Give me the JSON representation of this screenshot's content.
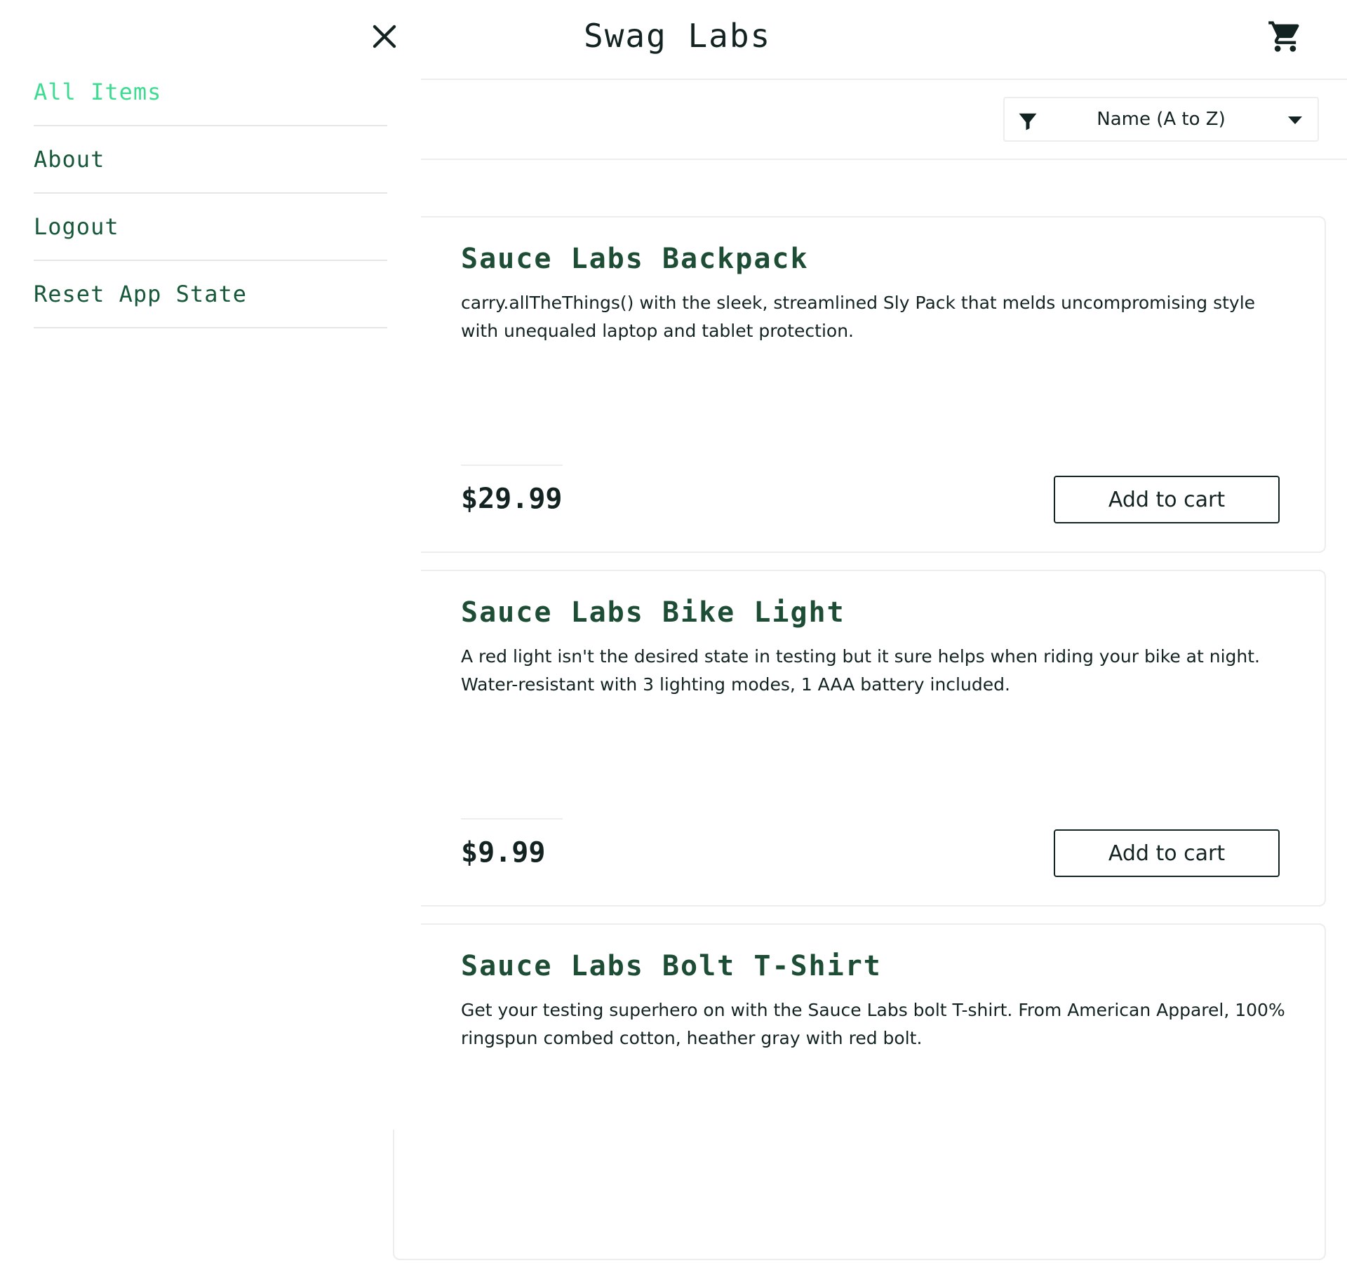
{
  "header": {
    "app_title": "Swag Labs",
    "cart_icon": "shopping-cart-icon"
  },
  "sort": {
    "icon": "filter-icon",
    "selected": "Name (A to Z)"
  },
  "menu": {
    "close_icon": "close-icon",
    "items": [
      {
        "label": "All Items",
        "active": true
      },
      {
        "label": "About",
        "active": false
      },
      {
        "label": "Logout",
        "active": false
      },
      {
        "label": "Reset App State",
        "active": false
      }
    ]
  },
  "products": [
    {
      "name": "Sauce Labs Backpack",
      "description": "carry.allTheThings() with the sleek, streamlined Sly Pack that melds uncompromising style with unequaled laptop and tablet protection.",
      "price": "$29.99",
      "button_label": "Add to cart"
    },
    {
      "name": "Sauce Labs Bike Light",
      "description": "A red light isn't the desired state in testing but it sure helps when riding your bike at night. Water-resistant with 3 lighting modes, 1 AAA battery included.",
      "price": "$9.99",
      "button_label": "Add to cart"
    },
    {
      "name": "Sauce Labs Bolt T-Shirt",
      "description": "Get your testing superhero on with the Sauce Labs bolt T-shirt. From American Apparel, 100% ringspun combed cotton, heather gray with red bolt.",
      "price": "",
      "button_label": ""
    }
  ],
  "colors": {
    "title_green": "#1e4d35",
    "menu_active": "#3ddc91",
    "menu_text": "#18583a",
    "text_dark": "#132322",
    "border": "#ededed"
  }
}
